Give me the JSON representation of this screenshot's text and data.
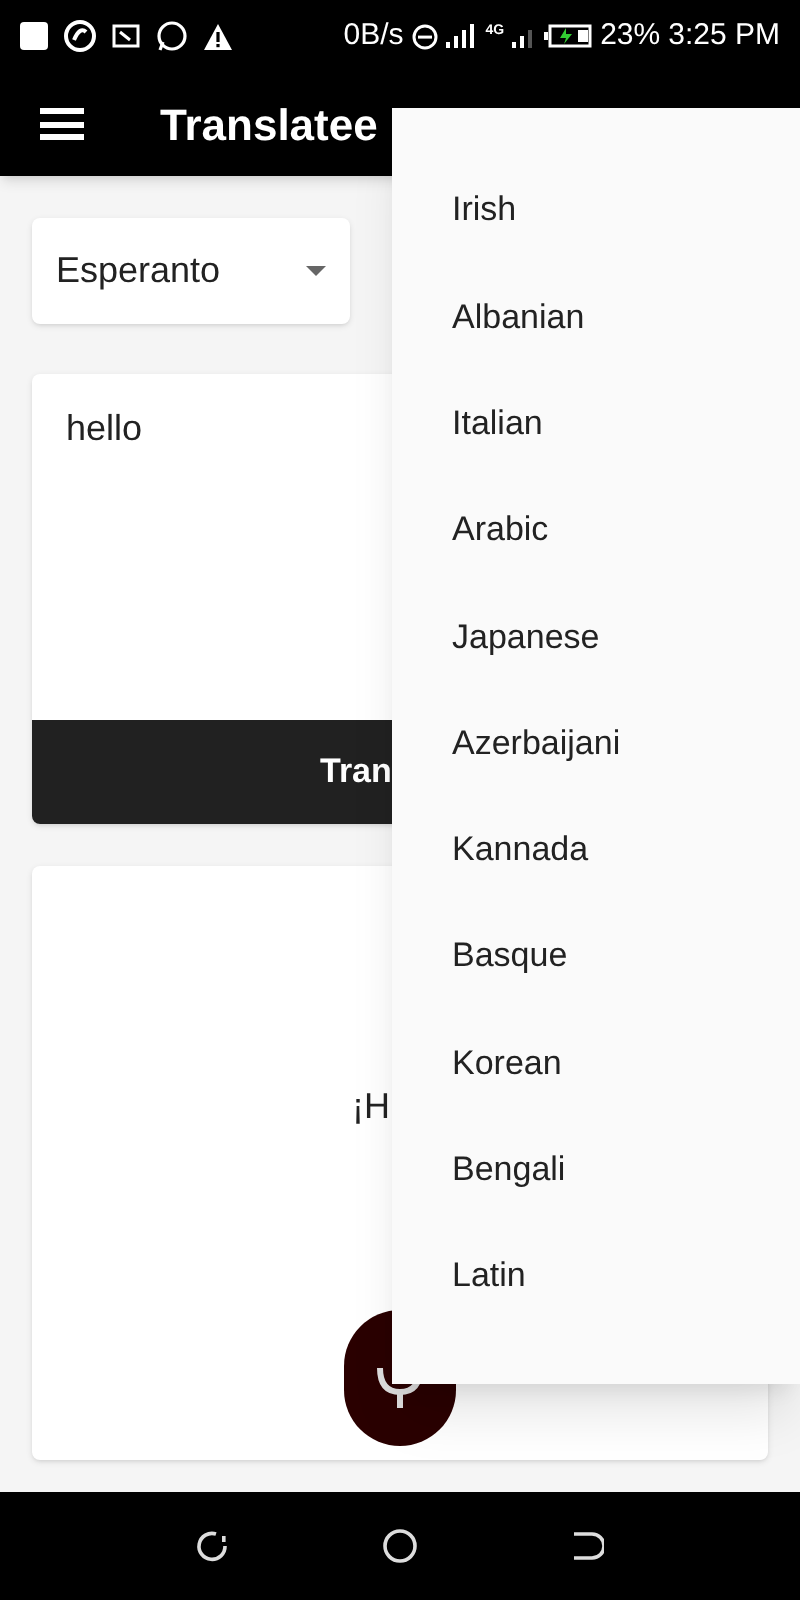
{
  "status_bar": {
    "speed": "0B/s",
    "network": "4G",
    "battery": "23%",
    "time": "3:25 PM"
  },
  "app_bar": {
    "title": "Translatee"
  },
  "source_language": {
    "value": "Esperanto"
  },
  "input": {
    "value": "hello"
  },
  "translate_button": {
    "label": "Tran"
  },
  "output": {
    "text": "¡H"
  },
  "language_menu": {
    "items": [
      {
        "label": "Irish"
      },
      {
        "label": "Albanian"
      },
      {
        "label": "Italian"
      },
      {
        "label": "Arabic"
      },
      {
        "label": "Japanese"
      },
      {
        "label": "Azerbaijani"
      },
      {
        "label": "Kannada"
      },
      {
        "label": "Basque"
      },
      {
        "label": "Korean"
      },
      {
        "label": "Bengali"
      },
      {
        "label": "Latin"
      }
    ]
  }
}
